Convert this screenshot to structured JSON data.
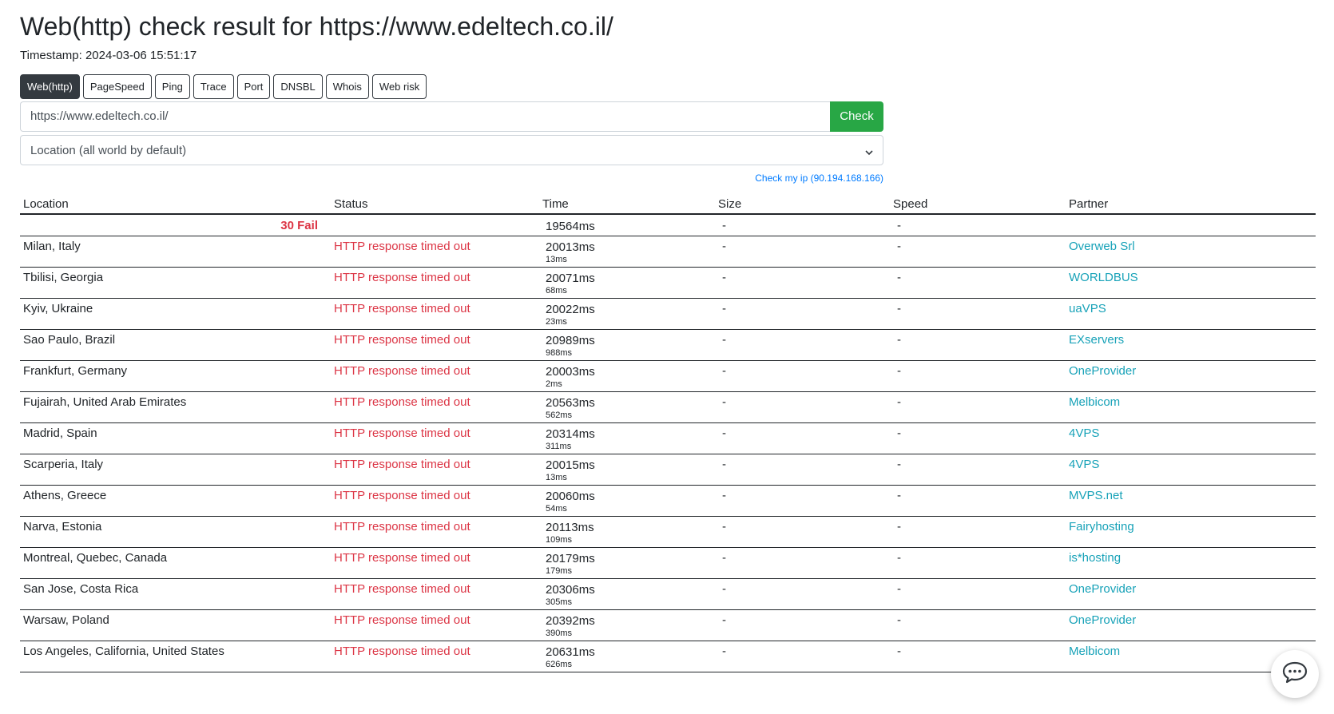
{
  "header": {
    "title": "Web(http) check result for https://www.edeltech.co.il/",
    "timestamp": "Timestamp: 2024-03-06 15:51:17"
  },
  "tabs": [
    {
      "label": "Web(http)",
      "active": true
    },
    {
      "label": "PageSpeed",
      "active": false
    },
    {
      "label": "Ping",
      "active": false
    },
    {
      "label": "Trace",
      "active": false
    },
    {
      "label": "Port",
      "active": false
    },
    {
      "label": "DNSBL",
      "active": false
    },
    {
      "label": "Whois",
      "active": false
    },
    {
      "label": "Web risk",
      "active": false
    }
  ],
  "form": {
    "url_value": "https://www.edeltech.co.il/",
    "check_label": "Check",
    "location_select": "Location (all world by default)",
    "check_my_ip": "Check my ip (90.194.168.166)"
  },
  "table": {
    "headers": {
      "location": "Location",
      "status": "Status",
      "time": "Time",
      "size": "Size",
      "speed": "Speed",
      "partner": "Partner"
    },
    "summary": {
      "fail": "30 Fail",
      "time": "19564ms",
      "size": "-",
      "speed": "-"
    },
    "rows": [
      {
        "location": "Milan, Italy",
        "status": "HTTP response timed out",
        "time": "20013ms",
        "sub": "13ms",
        "size": "-",
        "speed": "-",
        "partner": "Overweb Srl"
      },
      {
        "location": "Tbilisi, Georgia",
        "status": "HTTP response timed out",
        "time": "20071ms",
        "sub": "68ms",
        "size": "-",
        "speed": "-",
        "partner": "WORLDBUS"
      },
      {
        "location": "Kyiv, Ukraine",
        "status": "HTTP response timed out",
        "time": "20022ms",
        "sub": "23ms",
        "size": "-",
        "speed": "-",
        "partner": "uaVPS"
      },
      {
        "location": "Sao Paulo, Brazil",
        "status": "HTTP response timed out",
        "time": "20989ms",
        "sub": "988ms",
        "size": "-",
        "speed": "-",
        "partner": "EXservers"
      },
      {
        "location": "Frankfurt, Germany",
        "status": "HTTP response timed out",
        "time": "20003ms",
        "sub": "2ms",
        "size": "-",
        "speed": "-",
        "partner": "OneProvider"
      },
      {
        "location": "Fujairah, United Arab Emirates",
        "status": "HTTP response timed out",
        "time": "20563ms",
        "sub": "562ms",
        "size": "-",
        "speed": "-",
        "partner": "Melbicom"
      },
      {
        "location": "Madrid, Spain",
        "status": "HTTP response timed out",
        "time": "20314ms",
        "sub": "311ms",
        "size": "-",
        "speed": "-",
        "partner": "4VPS"
      },
      {
        "location": "Scarperia, Italy",
        "status": "HTTP response timed out",
        "time": "20015ms",
        "sub": "13ms",
        "size": "-",
        "speed": "-",
        "partner": "4VPS"
      },
      {
        "location": "Athens, Greece",
        "status": "HTTP response timed out",
        "time": "20060ms",
        "sub": "54ms",
        "size": "-",
        "speed": "-",
        "partner": "MVPS.net"
      },
      {
        "location": "Narva, Estonia",
        "status": "HTTP response timed out",
        "time": "20113ms",
        "sub": "109ms",
        "size": "-",
        "speed": "-",
        "partner": "Fairyhosting"
      },
      {
        "location": "Montreal, Quebec, Canada",
        "status": "HTTP response timed out",
        "time": "20179ms",
        "sub": "179ms",
        "size": "-",
        "speed": "-",
        "partner": "is*hosting"
      },
      {
        "location": "San Jose, Costa Rica",
        "status": "HTTP response timed out",
        "time": "20306ms",
        "sub": "305ms",
        "size": "-",
        "speed": "-",
        "partner": "OneProvider"
      },
      {
        "location": "Warsaw, Poland",
        "status": "HTTP response timed out",
        "time": "20392ms",
        "sub": "390ms",
        "size": "-",
        "speed": "-",
        "partner": "OneProvider"
      },
      {
        "location": "Los Angeles, California, United States",
        "status": "HTTP response timed out",
        "time": "20631ms",
        "sub": "626ms",
        "size": "-",
        "speed": "-",
        "partner": "Melbicom"
      }
    ]
  },
  "colors": {
    "primary_dark": "#343a40",
    "check_green": "#28a745",
    "fail_red": "#dc3545",
    "partner_teal": "#17a2b8",
    "link_blue": "#007bff"
  },
  "icons": {
    "select": "chevron-down-icon",
    "chat": "chat-bubble-icon"
  }
}
